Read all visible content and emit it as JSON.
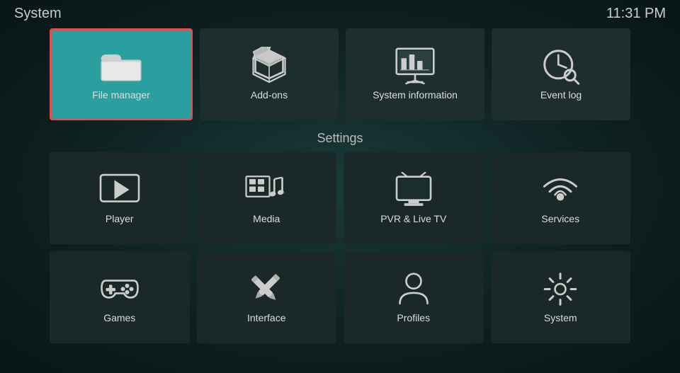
{
  "header": {
    "title": "System",
    "time": "11:31 PM"
  },
  "top_row": [
    {
      "id": "file-manager",
      "label": "File manager",
      "selected": true
    },
    {
      "id": "add-ons",
      "label": "Add-ons",
      "selected": false
    },
    {
      "id": "system-information",
      "label": "System information",
      "selected": false
    },
    {
      "id": "event-log",
      "label": "Event log",
      "selected": false
    }
  ],
  "settings_label": "Settings",
  "grid_row1": [
    {
      "id": "player",
      "label": "Player"
    },
    {
      "id": "media",
      "label": "Media"
    },
    {
      "id": "pvr-live-tv",
      "label": "PVR & Live TV"
    },
    {
      "id": "services",
      "label": "Services"
    }
  ],
  "grid_row2": [
    {
      "id": "games",
      "label": "Games"
    },
    {
      "id": "interface",
      "label": "Interface"
    },
    {
      "id": "profiles",
      "label": "Profiles"
    },
    {
      "id": "system",
      "label": "System"
    }
  ]
}
